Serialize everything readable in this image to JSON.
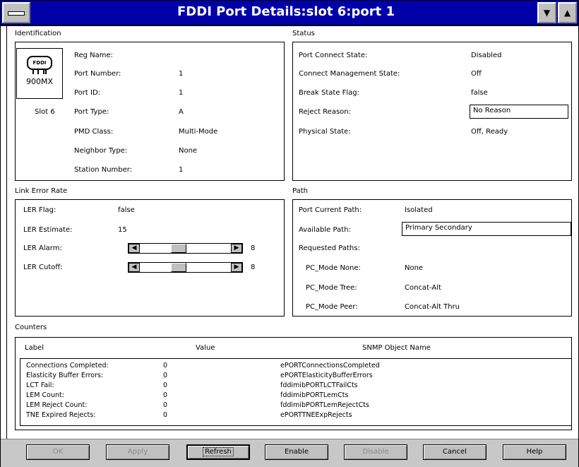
{
  "window": {
    "title": "FDDI Port Details:slot 6:port 1",
    "min_symbol": "▼",
    "max_symbol": "▲"
  },
  "identification": {
    "section_title": "Identification",
    "device_badge": "FDDI",
    "device_model": "900MX",
    "slot_label": "Slot  6",
    "fields": [
      {
        "label": "Reg Name:",
        "value": ""
      },
      {
        "label": "Port Number:",
        "value": "1"
      },
      {
        "label": "Port ID:",
        "value": "1"
      },
      {
        "label": "Port Type:",
        "value": "A"
      },
      {
        "label": "PMD Class:",
        "value": "Multi-Mode"
      },
      {
        "label": "Neighbor Type:",
        "value": "None"
      },
      {
        "label": "Station Number:",
        "value": "1"
      }
    ]
  },
  "status": {
    "section_title": "Status",
    "fields": [
      {
        "label": "Port Connect State:",
        "value": "Disabled"
      },
      {
        "label": "Connect Management State:",
        "value": "Off"
      },
      {
        "label": "Break State Flag:",
        "value": "false"
      },
      {
        "label": "Reject Reason:",
        "value": "No Reason"
      },
      {
        "label": "Physical State:",
        "value": "Off, Ready"
      }
    ]
  },
  "link_error_rate": {
    "section_title": "Link Error Rate",
    "ler_flag_label": "LER Flag:",
    "ler_flag_value": "false",
    "ler_estimate_label": "LER Estimate:",
    "ler_estimate_value": "15",
    "ler_alarm_label": "LER Alarm:",
    "ler_alarm_value": "8",
    "ler_cutoff_label": "LER Cutoff:",
    "ler_cutoff_value": "8",
    "arrow_left": "◀",
    "arrow_right": "▶"
  },
  "path": {
    "section_title": "Path",
    "current_path_label": "Port Current Path:",
    "current_path_value": "Isolated",
    "available_path_label": "Available Path:",
    "available_path_value": "Primary Secondary",
    "requested_paths_label": "Requested Paths:",
    "pc_mode": [
      {
        "label": "PC_Mode None:",
        "value": "None"
      },
      {
        "label": "PC_Mode Tree:",
        "value": "Concat-Alt"
      },
      {
        "label": "PC_Mode Peer:",
        "value": "Concat-Alt Thru"
      }
    ]
  },
  "counters": {
    "section_title": "Counters",
    "columns": [
      "Label",
      "Value",
      "SNMP Object Name"
    ],
    "rows": [
      {
        "label": "Connections Completed:",
        "value": "0",
        "snmp": "ePORTConnectionsCompleted"
      },
      {
        "label": "Elasticity Buffer Errors:",
        "value": "0",
        "snmp": "ePORTElasticityBufferErrors"
      },
      {
        "label": "LCT Fail:",
        "value": "0",
        "snmp": "fddimibPORTLCTFailCts"
      },
      {
        "label": "LEM Count:",
        "value": "0",
        "snmp": "fddimibPORTLemCts"
      },
      {
        "label": "LEM Reject Count:",
        "value": "0",
        "snmp": "fddimibPORTLemRejectCts"
      },
      {
        "label": "TNE Expired Rejects:",
        "value": "0",
        "snmp": "ePORTTNEExpRejects"
      }
    ]
  },
  "buttons": {
    "ok": "OK",
    "apply": "Apply",
    "refresh": "Refresh",
    "enable": "Enable",
    "disable": "Disable",
    "cancel": "Cancel",
    "help": "Help"
  }
}
